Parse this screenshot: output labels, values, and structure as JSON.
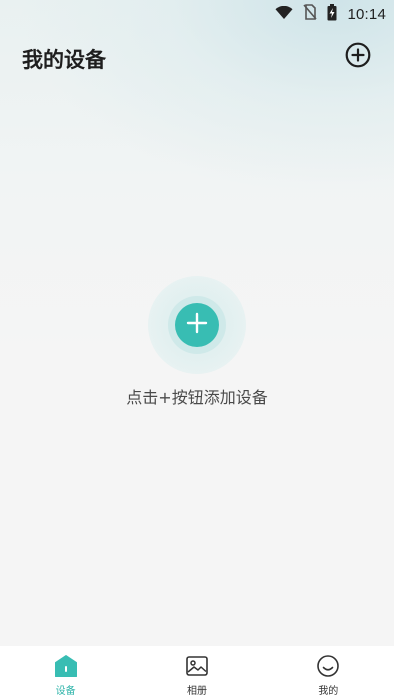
{
  "status_bar": {
    "time": "10:14",
    "icons": [
      "wifi-icon",
      "no-sim-icon",
      "battery-charging-icon"
    ]
  },
  "header": {
    "title": "我的设备",
    "add_icon": "plus-circle-outline-icon"
  },
  "empty_state": {
    "button_icon": "plus-icon",
    "hint": "点击+按钮添加设备"
  },
  "bottom_nav": {
    "items": [
      {
        "label": "设备",
        "icon": "home-icon",
        "active": true
      },
      {
        "label": "相册",
        "icon": "image-icon",
        "active": false
      },
      {
        "label": "我的",
        "icon": "smiley-icon",
        "active": false
      }
    ]
  },
  "colors": {
    "accent": "#38bdb3",
    "active_nav": "#2fb4aa",
    "title": "#1e1e1e",
    "background": "#f5f5f5"
  }
}
